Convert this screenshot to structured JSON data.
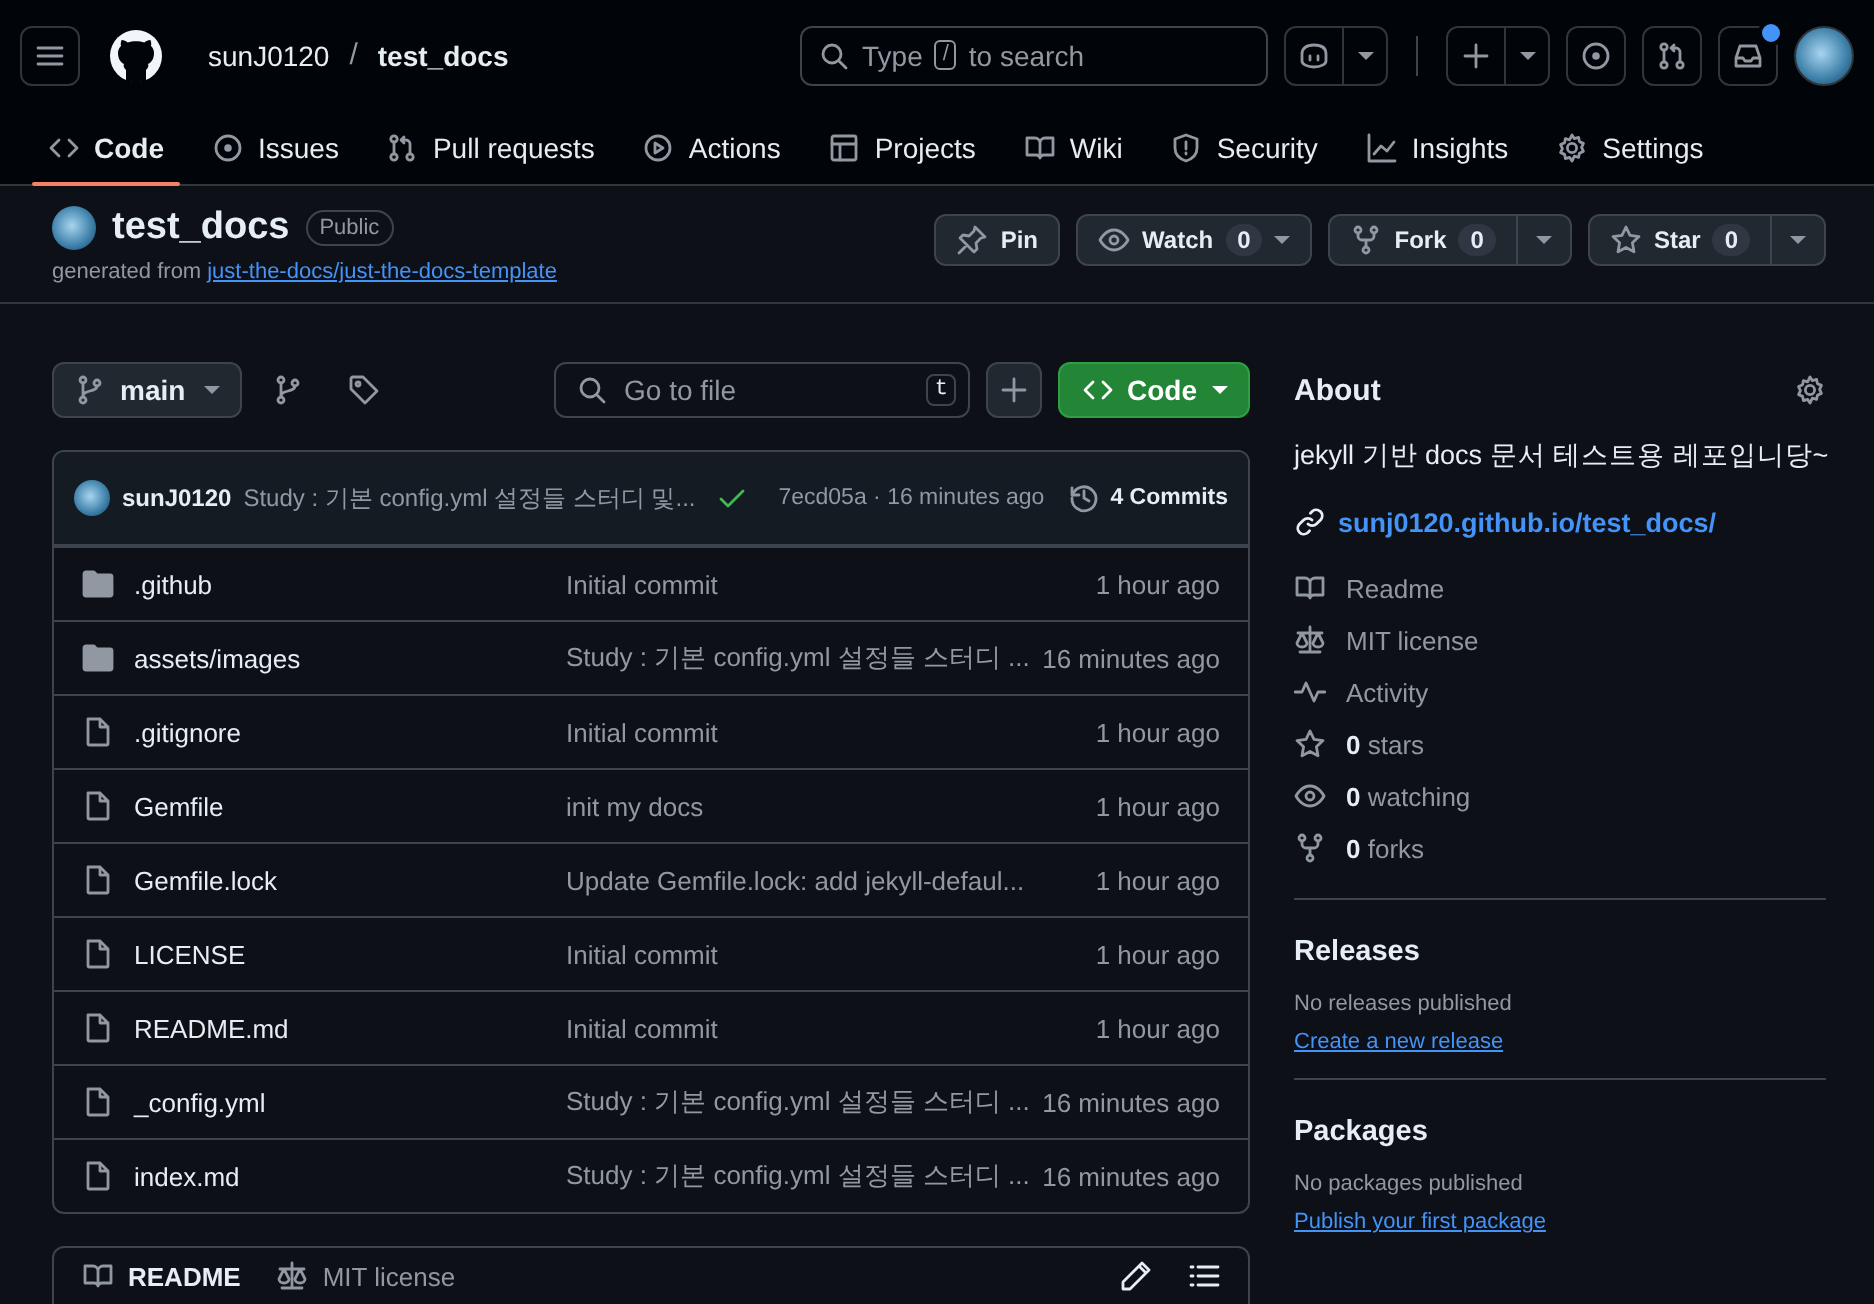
{
  "header": {
    "owner": "sunJ0120",
    "separator": "/",
    "repo": "test_docs",
    "search": {
      "before": "Type",
      "key": "/",
      "after": "to search"
    },
    "inbox_unread": true
  },
  "nav": [
    {
      "label": "Code",
      "selected": true
    },
    {
      "label": "Issues",
      "selected": false
    },
    {
      "label": "Pull requests",
      "selected": false
    },
    {
      "label": "Actions",
      "selected": false
    },
    {
      "label": "Projects",
      "selected": false
    },
    {
      "label": "Wiki",
      "selected": false
    },
    {
      "label": "Security",
      "selected": false
    },
    {
      "label": "Insights",
      "selected": false
    },
    {
      "label": "Settings",
      "selected": false
    }
  ],
  "repo": {
    "name": "test_docs",
    "visibility": "Public",
    "generated_from": "generated from",
    "template": "just-the-docs/just-the-docs-template",
    "actions": [
      {
        "kind": "pin",
        "label": "Pin"
      },
      {
        "kind": "watch",
        "label": "Watch",
        "count": "0"
      },
      {
        "kind": "fork",
        "label": "Fork",
        "count": "0"
      },
      {
        "kind": "star",
        "label": "Star",
        "count": "0"
      }
    ]
  },
  "toolbar": {
    "branch": "main",
    "go_to_file": {
      "placeholder": "Go to file",
      "shortcut": "t"
    },
    "code_button": "Code"
  },
  "latest_commit": {
    "author": "sunJ0120",
    "message": "Study : 기본 config.yml 설정들 스터디 및...",
    "checks_passed": true,
    "hash_time": "7ecd05a · 16 minutes ago",
    "commits": "4 Commits"
  },
  "files": [
    {
      "kind": "folder",
      "name": ".github",
      "message": "Initial commit",
      "time": "1 hour ago"
    },
    {
      "kind": "folder",
      "name": "assets/images",
      "message": "Study : 기본 config.yml 설정들 스터디 ...",
      "time": "16 minutes ago"
    },
    {
      "kind": "file",
      "name": ".gitignore",
      "message": "Initial commit",
      "time": "1 hour ago"
    },
    {
      "kind": "file",
      "name": "Gemfile",
      "message": "init my docs",
      "time": "1 hour ago"
    },
    {
      "kind": "file",
      "name": "Gemfile.lock",
      "message": "Update Gemfile.lock: add jekyll-defaul...",
      "time": "1 hour ago"
    },
    {
      "kind": "file",
      "name": "LICENSE",
      "message": "Initial commit",
      "time": "1 hour ago"
    },
    {
      "kind": "file",
      "name": "README.md",
      "message": "Initial commit",
      "time": "1 hour ago"
    },
    {
      "kind": "file",
      "name": "_config.yml",
      "message": "Study : 기본 config.yml 설정들 스터디 ...",
      "time": "16 minutes ago"
    },
    {
      "kind": "file",
      "name": "index.md",
      "message": "Study : 기본 config.yml 설정들 스터디 ...",
      "time": "16 minutes ago"
    }
  ],
  "readme_tabs": [
    {
      "label": "README",
      "selected": true
    },
    {
      "label": "MIT license",
      "selected": false
    }
  ],
  "about": {
    "title": "About",
    "description": "jekyll 기반 docs 문서 테스트용 레포입니당~",
    "website": "sunj0120.github.io/test_docs/",
    "items": [
      "Readme",
      "MIT license",
      "Activity",
      "**0** stars",
      "**0** watching",
      "**0** forks"
    ]
  },
  "releases": {
    "title": "Releases",
    "empty": "No releases published",
    "link": "Create a new release"
  },
  "packages": {
    "title": "Packages",
    "empty": "No packages published",
    "link": "Publish your first package"
  }
}
